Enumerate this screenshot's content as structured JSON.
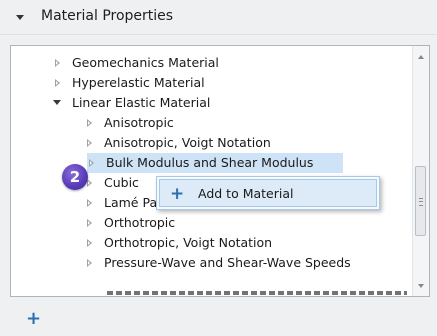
{
  "section": {
    "title": "Material Properties"
  },
  "tree": {
    "items": [
      {
        "label": "Geomechanics Material",
        "expander": "collapsed"
      },
      {
        "label": "Hyperelastic Material",
        "expander": "collapsed"
      },
      {
        "label": "Linear Elastic Material",
        "expander": "expanded"
      },
      {
        "label": "Anisotropic",
        "expander": "collapsed"
      },
      {
        "label": "Anisotropic, Voigt Notation",
        "expander": "collapsed"
      },
      {
        "label": "Bulk Modulus and Shear Modulus",
        "expander": "collapsed",
        "selected": true
      },
      {
        "label": "Cubic",
        "expander": "collapsed"
      },
      {
        "label": "Lamé Parameters",
        "expander": "collapsed"
      },
      {
        "label": "Orthotropic",
        "expander": "collapsed"
      },
      {
        "label": "Orthotropic, Voigt Notation",
        "expander": "collapsed"
      },
      {
        "label": "Pressure-Wave and Shear-Wave Speeds",
        "expander": "collapsed"
      }
    ]
  },
  "callout": {
    "number": "2",
    "color": "#5a3dbb"
  },
  "context_menu": {
    "item_label": "Add to Material",
    "icon": "plus-icon"
  },
  "toolbar": {
    "add_icon": "plus-icon"
  },
  "colors": {
    "accent_blue": "#2d6fb0",
    "selection": "#cfe3f7",
    "header_bg": "#eef0f2"
  }
}
